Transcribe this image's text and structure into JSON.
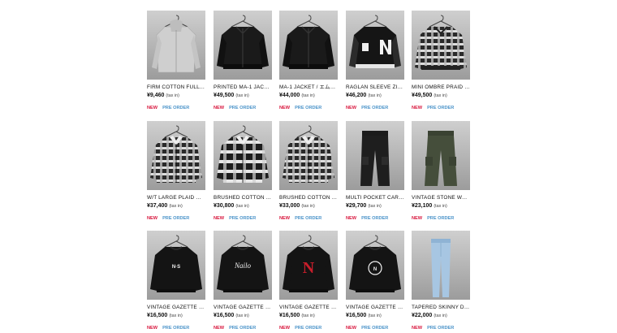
{
  "products": [
    {
      "name": "FIRM COTTON FULL Z...",
      "price": "¥9,460",
      "tax": "(tax in)",
      "new": "NEW",
      "preorder": "PRE ORDER",
      "icon": "hoodie-gray-icon"
    },
    {
      "name": "PRINTED MA-1 JACKE...",
      "price": "¥49,500",
      "tax": "(tax in)",
      "new": "NEW",
      "preorder": "PRE ORDER",
      "icon": "ma1-jacket-black-icon"
    },
    {
      "name": "MA-1 JACKET / エムエ...",
      "price": "¥44,000",
      "tax": "(tax in)",
      "new": "NEW",
      "preorder": "PRE ORDER",
      "icon": "ma1-jacket-black-icon"
    },
    {
      "name": "RAGLAN SLEEVE ZIPP...",
      "price": "¥46,200",
      "tax": "(tax in)",
      "new": "NEW",
      "preorder": "PRE ORDER",
      "icon": "varsity-jacket-icon"
    },
    {
      "name": "MINI OMBRE PRAID IN...",
      "price": "¥49,500",
      "tax": "(tax in)",
      "new": "NEW",
      "preorder": "PRE ORDER",
      "icon": "plaid-jacket-icon"
    },
    {
      "name": "W/T LARGE PLAID ME...",
      "price": "¥37,400",
      "tax": "(tax in)",
      "new": "NEW",
      "preorder": "PRE ORDER",
      "icon": "plaid-shirt-icon"
    },
    {
      "name": "BRUSHED COTTON O...",
      "price": "¥30,800",
      "tax": "(tax in)",
      "new": "NEW",
      "preorder": "PRE ORDER",
      "icon": "ombre-shirt-icon"
    },
    {
      "name": "BRUSHED COTTON O...",
      "price": "¥33,000",
      "tax": "(tax in)",
      "new": "NEW",
      "preorder": "PRE ORDER",
      "icon": "plaid-shirt-icon"
    },
    {
      "name": "MULTI POCKET CARG...",
      "price": "¥29,700",
      "tax": "(tax in)",
      "new": "NEW",
      "preorder": "PRE ORDER",
      "icon": "cargo-pants-black-icon"
    },
    {
      "name": "VINTAGE STONE WAS...",
      "price": "¥23,100",
      "tax": "(tax in)",
      "new": "NEW",
      "preorder": "PRE ORDER",
      "icon": "cargo-pants-olive-icon"
    },
    {
      "name": "VINTAGE GAZETTE N-...",
      "price": "¥16,500",
      "tax": "(tax in)",
      "new": "NEW",
      "preorder": "PRE ORDER",
      "icon": "sweatshirt-ns-icon"
    },
    {
      "name": "VINTAGE GAZETTE N...",
      "price": "¥16,500",
      "tax": "(tax in)",
      "new": "NEW",
      "preorder": "PRE ORDER",
      "icon": "sweatshirt-script-icon"
    },
    {
      "name": "VINTAGE GAZETTE N-...",
      "price": "¥16,500",
      "tax": "(tax in)",
      "new": "NEW",
      "preorder": "PRE ORDER",
      "icon": "sweatshirt-red-n-icon"
    },
    {
      "name": "VINTAGE GAZETTE C...",
      "price": "¥16,500",
      "tax": "(tax in)",
      "new": "NEW",
      "preorder": "PRE ORDER",
      "icon": "sweatshirt-college-icon"
    },
    {
      "name": "TAPERED SKINNY DE...",
      "price": "¥22,000",
      "tax": "(tax in)",
      "new": "NEW",
      "preorder": "PRE ORDER",
      "icon": "denim-jeans-icon"
    }
  ],
  "colors": {
    "new_tag": "#d8143c",
    "preorder_tag": "#4a93c9",
    "text": "#111111",
    "background": "#ffffff"
  }
}
